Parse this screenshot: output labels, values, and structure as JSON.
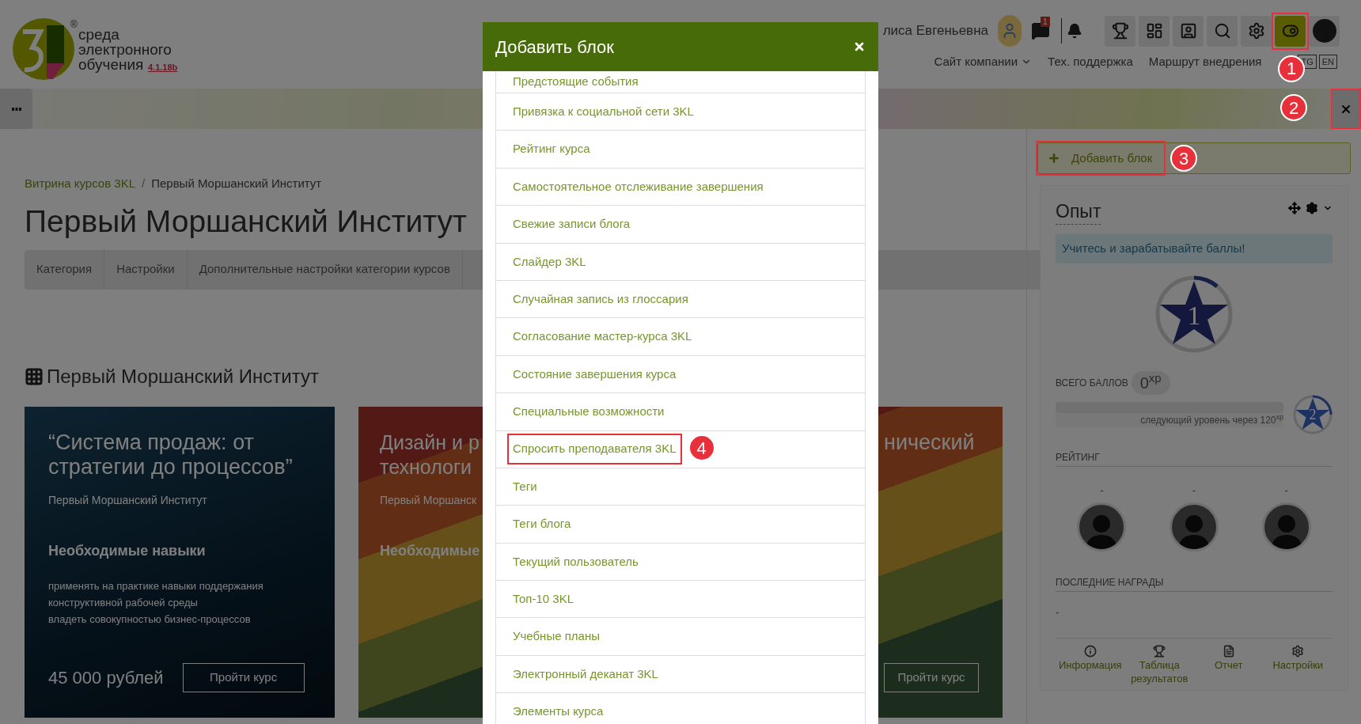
{
  "header": {
    "logo": {
      "registered": "®",
      "lines": [
        "среда",
        "электронного",
        "обучения"
      ],
      "version": "4.1.18b"
    },
    "user_name": "лиса Евгеньевна",
    "messages_badge": "1",
    "toolbar_buttons": [
      {
        "selected": false
      },
      {
        "selected": false
      },
      {
        "selected": false
      },
      {
        "selected": false
      },
      {
        "selected": false
      },
      {
        "selected": true,
        "callout": "1"
      },
      {
        "selected": false
      }
    ],
    "nav": [
      {
        "label": "Сайт компании",
        "dropdown": true
      },
      {
        "label": "Тех. поддержка",
        "dropdown": false
      },
      {
        "label": "Маршрут внедрения",
        "dropdown": false
      }
    ],
    "languages": [
      "TG",
      "EN"
    ]
  },
  "toolbar": {
    "close_button": {
      "callout": "2"
    }
  },
  "breadcrumb": [
    {
      "label": "Витрина курсов 3KL",
      "link": true
    },
    {
      "label": "Первый Моршанский Институт",
      "link": false
    }
  ],
  "breadcrumb_separator": "/",
  "page_title": "Первый Моршанский Институт",
  "category_menu": [
    "Категория",
    "Настройки",
    "Дополнительные настройки категории курсов"
  ],
  "section_title": "Первый Моршанский Институт",
  "courses": [
    {
      "kind": "full",
      "title_lines": [
        "“Система продаж: от",
        "стратегии до процессов”"
      ],
      "institute": "Первый Моршанский Институт",
      "skills_title": "Необходимые навыки",
      "skills": [
        "применять на практике навыки поддержания",
        "конструктивной рабочей среды",
        "владеть совокупностью бизнес-процессов"
      ],
      "price": "45 000 рублей",
      "button": "Пройти курс"
    },
    {
      "kind": "cut_right",
      "title_lines": [
        "Дизайн и р",
        "технологи"
      ],
      "institute": "Первый Моршанск",
      "skills_title": "Необходимые"
    },
    {
      "kind": "cut_left",
      "title_lines": [
        "нический"
      ],
      "button": "Пройти курс"
    }
  ],
  "sidebar": {
    "add_block": {
      "label": "Добавить блок",
      "callout": "3"
    },
    "block": {
      "title": "Опыт",
      "notice": "Учитесь и зарабатывайте баллы!",
      "level": "1",
      "total_label": "ВСЕГО БАЛЛОВ",
      "total": "0$^{xp}$",
      "progress": {
        "level": 0
      },
      "next_level_text": "следующий уровень через 120$^{xp}$",
      "next_level": "2",
      "rating_title": "РЕЙТИНГ",
      "rating": [
        "-",
        "-",
        "-"
      ],
      "awards_title": "ПОСЛЕДНИЕ НАГРАДЫ",
      "awards": "-",
      "footer_links": [
        "Информация",
        "Таблица результатов",
        "Отчет",
        "Настройки"
      ]
    }
  },
  "modal": {
    "title": "Добавить блок",
    "items": [
      {
        "label": "Предстоящие события"
      },
      {
        "label": "Привязка к социальной сети 3KL"
      },
      {
        "label": "Рейтинг курса"
      },
      {
        "label": "Самостоятельное отслеживание завершения"
      },
      {
        "label": "Свежие записи блога"
      },
      {
        "label": "Слайдер 3KL"
      },
      {
        "label": "Случайная запись из глоссария"
      },
      {
        "label": "Согласование мастер-курса 3KL"
      },
      {
        "label": "Состояние завершения курса"
      },
      {
        "label": "Специальные возможности"
      },
      {
        "label": "Спросить преподавателя 3KL",
        "callout": "4"
      },
      {
        "label": "Теги"
      },
      {
        "label": "Теги блога"
      },
      {
        "label": "Текущий пользователь"
      },
      {
        "label": "Топ-10 3KL"
      },
      {
        "label": "Учебные планы"
      },
      {
        "label": "Электронный деканат 3KL"
      },
      {
        "label": "Элементы курса"
      }
    ]
  }
}
